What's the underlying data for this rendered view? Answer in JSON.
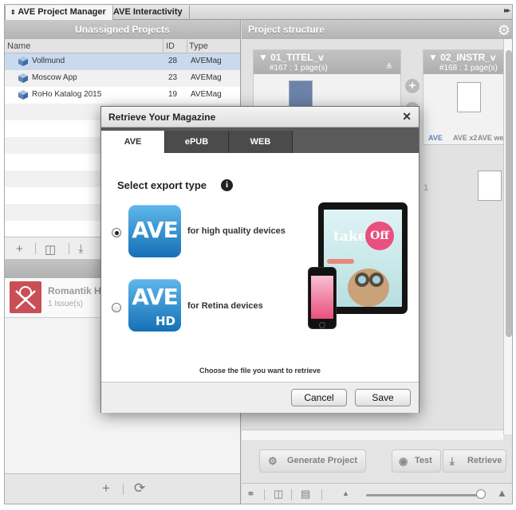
{
  "tabs": [
    {
      "label": "AVE Project Manager",
      "active": true
    },
    {
      "label": "AVE Interactivity",
      "active": false
    }
  ],
  "left_panel": {
    "title": "Unassigned Projects",
    "columns": [
      "Name",
      "ID",
      "Type"
    ],
    "rows": [
      {
        "name": "Vollmund",
        "id": "28",
        "type": "AVEMag",
        "selected": true
      },
      {
        "name": "Moscow App",
        "id": "23",
        "type": "AVEMag",
        "selected": false
      },
      {
        "name": "RoHo Katalog 2015",
        "id": "19",
        "type": "AVEMag",
        "selected": false
      }
    ],
    "issue": {
      "title": "Romantik H",
      "sub": "1  Issue(s)"
    }
  },
  "right_panel": {
    "title": "Project structure",
    "cards": [
      {
        "name": "01_TITEL_v",
        "info": "#167 : 1 page(s)"
      },
      {
        "name": "02_INSTR_v",
        "info": "#168 : 1 page(s)"
      }
    ],
    "generate_label": "Generate Project",
    "test_label": "Test",
    "retrieve_label": "Retrieve",
    "export_icons": [
      "AVE",
      "AVE x2",
      "AVE web"
    ],
    "partial_digit": "1"
  },
  "modal": {
    "title": "Retrieve Your Magazine",
    "tabs": [
      "AVE",
      "ePUB",
      "WEB"
    ],
    "select_title": "Select export type",
    "options": [
      {
        "logo": "AVE",
        "label": "for high quality devices",
        "selected": true
      },
      {
        "logo": "AVE",
        "logo_sub": "HD",
        "label": "for Retina devices",
        "selected": false
      }
    ],
    "magazine_take": "take",
    "magazine_off": "Off",
    "choose_text": "Choose the file you want to retrieve",
    "cancel_label": "Cancel",
    "save_label": "Save"
  },
  "colors": {
    "accent_blue": "#1570b6",
    "selection": "#c9d9ee",
    "logo_red": "#c94f57",
    "magazine_pink": "#e9507d"
  }
}
